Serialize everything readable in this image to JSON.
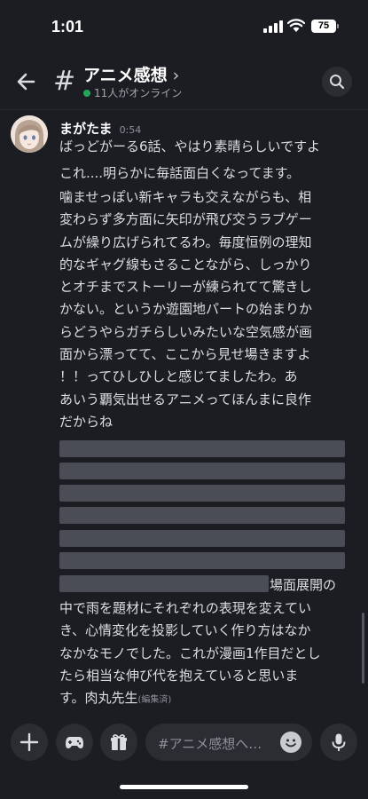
{
  "status_bar": {
    "time": "1:01",
    "battery": "75"
  },
  "header": {
    "channel_name": "アニメ感想",
    "chevron": "›",
    "online_text": "11人がオンライン"
  },
  "message": {
    "author": "まがたま",
    "timestamp": "0:54",
    "line1": "ばっどがーる6話、やはり素晴らしいですよ",
    "line2": "これ....明らかに毎話面白くなってます。",
    "paragraph_lines": [
      "噛ませっぽい新キャラも交えながらも、相",
      "変わらず多方面に矢印が飛び交うラブゲー",
      "ムが繰り広げられてるわ。毎度恒例の理知",
      "的なギャグ線もさることながら、しっかり",
      "とオチまでストーリーが練られてて驚きし",
      "かない。というか遊園地パートの始まりか",
      "らどうやらガチらしいみたいな空気感が画",
      "面から漂ってて、ここから見せ場きますよ",
      "！！ってひしひしと感じてましたわ。あ",
      "あいう覇気出せるアニメってほんまに良作",
      "だからね"
    ],
    "spoiler_tail": "場面展開の",
    "closing_lines": [
      "中で雨を題材にそれぞれの表現を変えてい",
      "き、心情変化を投影していく作り方はなか",
      "なかなモノでした。これが漫画1作目だとし",
      "たら相当な伸び代を抱えていると思いま"
    ],
    "last_line": "す。肉丸先生",
    "edited_label": "(編集済)"
  },
  "composer": {
    "placeholder": "#アニメ感想へ…"
  },
  "icons": {
    "back": "arrow-left-icon",
    "hash": "hash-icon",
    "search": "search-icon",
    "add": "plus-icon",
    "games": "gamepad-icon",
    "gift": "gift-icon",
    "emoji": "emoji-icon",
    "mic": "microphone-icon"
  },
  "colors": {
    "background": "#1c1d22",
    "online": "#23a55a",
    "spoiler": "#4a4d56"
  }
}
